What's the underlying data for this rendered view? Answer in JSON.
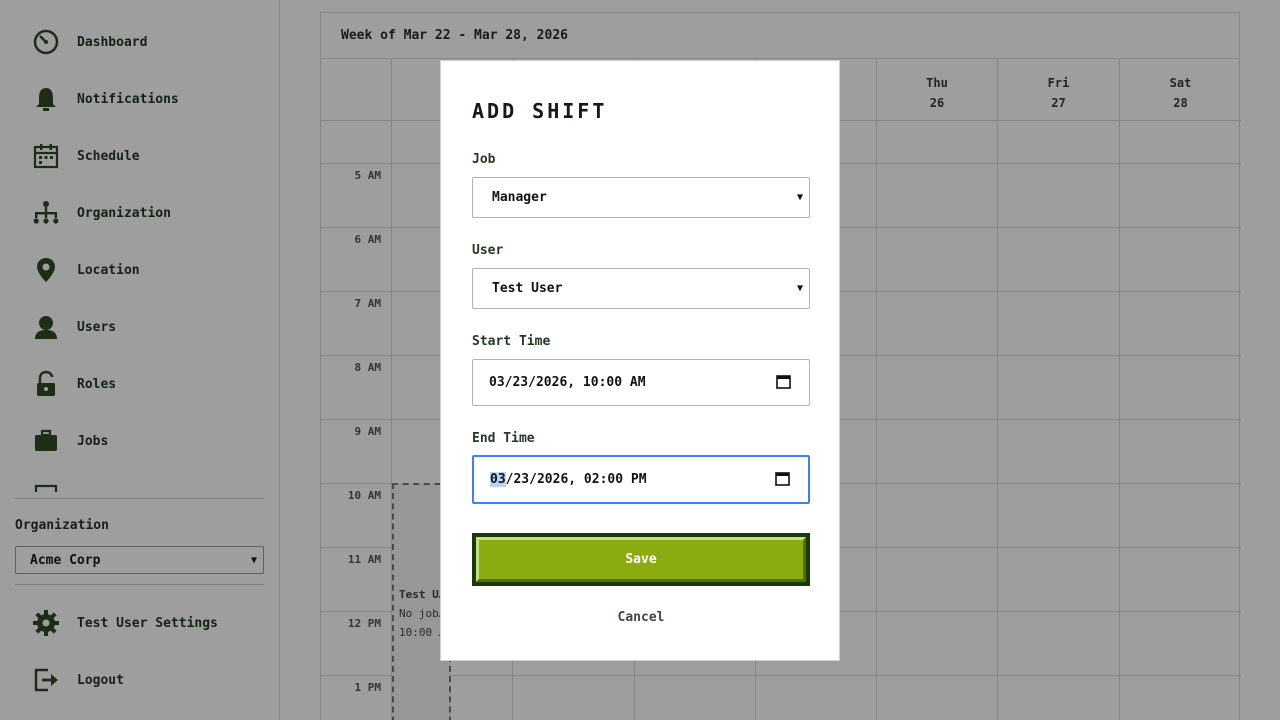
{
  "sidebar": {
    "items": [
      {
        "label": "Dashboard",
        "icon": "dashboard-icon"
      },
      {
        "label": "Notifications",
        "icon": "bell-icon"
      },
      {
        "label": "Schedule",
        "icon": "calendar-icon"
      },
      {
        "label": "Organization",
        "icon": "org-chart-icon"
      },
      {
        "label": "Location",
        "icon": "location-pin-icon"
      },
      {
        "label": "Users",
        "icon": "user-icon"
      },
      {
        "label": "Roles",
        "icon": "lock-icon"
      },
      {
        "label": "Jobs",
        "icon": "briefcase-icon"
      }
    ],
    "org_label": "Organization",
    "org_selected": "Acme Corp",
    "settings_label": "Test User Settings",
    "logout_label": "Logout"
  },
  "calendar": {
    "week_title": "Week of Mar 22 - Mar 28, 2026",
    "days": [
      {
        "name": "Thu",
        "num": "26"
      },
      {
        "name": "Fri",
        "num": "27"
      },
      {
        "name": "Sat",
        "num": "28"
      }
    ],
    "hours": [
      "5 AM",
      "6 AM",
      "7 AM",
      "8 AM",
      "9 AM",
      "10 AM",
      "11 AM",
      "12 PM",
      "1 PM"
    ],
    "event": {
      "user": "Test U…",
      "job": "No job…",
      "time": "10:00 …"
    }
  },
  "modal": {
    "title": "Add Shift",
    "job_label": "Job",
    "job_value": "Manager",
    "user_label": "User",
    "user_value": "Test User",
    "start_label": "Start Time",
    "start_value": "03/23/2026, 10:00 AM",
    "end_label": "End Time",
    "end_month": "03",
    "end_rest": "/23/2026, 02:00 PM",
    "save_label": "Save",
    "cancel_label": "Cancel"
  },
  "colors": {
    "accent_green": "#8aac10",
    "dark_green": "#1b3a0a",
    "icon_green": "#2f4a24",
    "focus_blue": "#3b82f6"
  }
}
